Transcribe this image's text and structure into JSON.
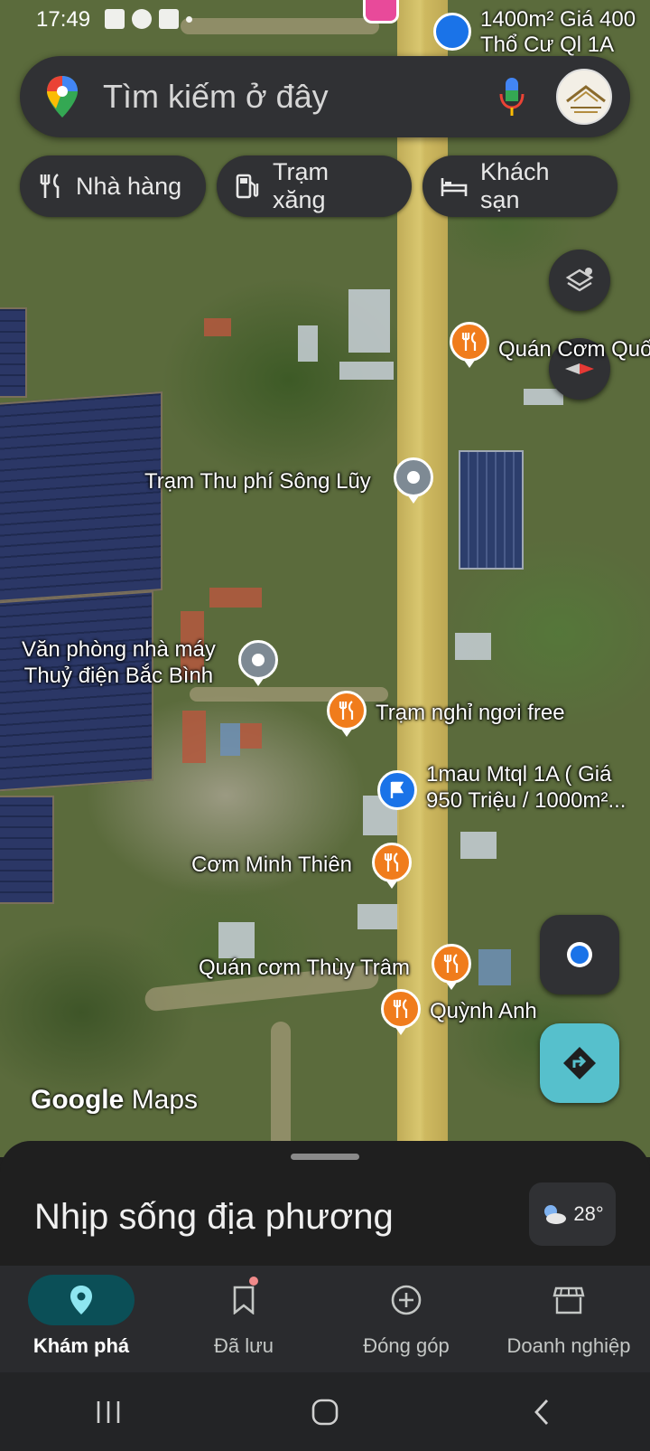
{
  "status_bar": {
    "time": "17:49",
    "battery": "1400m²Giá 400"
  },
  "top_label": {
    "line1": "1400m² Giá 400",
    "line2": "Thổ Cư Ql 1A"
  },
  "search": {
    "placeholder": "Tìm kiếm ở đây",
    "icons": [
      "google-maps-pin-icon",
      "microphone-icon",
      "avatar-icon"
    ]
  },
  "chips": [
    {
      "label": "Nhà hàng",
      "icon": "fork-knife-icon"
    },
    {
      "label": "Trạm xăng",
      "icon": "gas-station-icon"
    },
    {
      "label": "Khách sạn",
      "icon": "bed-icon"
    }
  ],
  "map_places": {
    "quan_com_quoc": "Quán Cơm Quố",
    "tram_thu_phi": "Trạm Thu phí Sông Lũy",
    "van_phong_line1": "Văn phòng nhà máy",
    "van_phong_line2": "Thuỷ điện Bắc Bình",
    "tram_nghi": "Trạm nghỉ ngơi free",
    "mau_line1": "1mau Mtql 1A ( Giá",
    "mau_line2": "950 Triệu / 1000m²...",
    "com_minh_thien": "Cơm Minh Thiên",
    "quan_com_thuy_tram": "Quán cơm Thùy Trâm",
    "quynh_anh": "Quỳnh Anh"
  },
  "watermark": {
    "google": "Google",
    "maps": "Maps"
  },
  "sheet": {
    "title": "Nhịp sống địa phương",
    "weather_temp": "28°"
  },
  "nav": {
    "items": [
      {
        "label": "Khám phá",
        "icon": "explore-pin-icon",
        "active": true
      },
      {
        "label": "Đã lưu",
        "icon": "bookmark-icon",
        "active": false
      },
      {
        "label": "Đóng góp",
        "icon": "add-circle-icon",
        "active": false
      },
      {
        "label": "Doanh nghiệp",
        "icon": "storefront-icon",
        "active": false
      }
    ]
  },
  "colors": {
    "accent": "#1a73e8",
    "pin_orange": "#f07c1c",
    "direction_button": "#56c0cc",
    "active_nav": "#0b4f57"
  }
}
